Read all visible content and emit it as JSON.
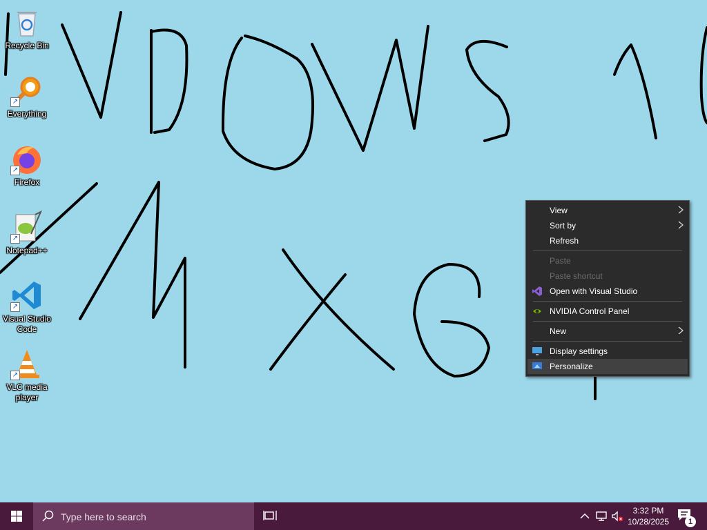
{
  "desktop": {
    "background_color": "#9cd8ea",
    "icons": [
      {
        "label": "Recycle Bin",
        "icon": "recycle-bin-icon",
        "shortcut": false
      },
      {
        "label": "Everything",
        "icon": "everything-search-icon",
        "shortcut": true
      },
      {
        "label": "Firefox",
        "icon": "firefox-icon",
        "shortcut": true
      },
      {
        "label": "Notepad++",
        "icon": "notepadpp-icon",
        "shortcut": true
      },
      {
        "label": "Visual Studio Code",
        "icon": "vscode-icon",
        "shortcut": true
      },
      {
        "label": "VLC media player",
        "icon": "vlc-icon",
        "shortcut": true
      }
    ]
  },
  "context_menu": {
    "items": [
      {
        "label": "View",
        "submenu": true,
        "disabled": false
      },
      {
        "label": "Sort by",
        "submenu": true,
        "disabled": false
      },
      {
        "label": "Refresh",
        "submenu": false,
        "disabled": false
      },
      {
        "label": "Paste",
        "submenu": false,
        "disabled": true
      },
      {
        "label": "Paste shortcut",
        "submenu": false,
        "disabled": true
      },
      {
        "label": "Open with Visual Studio",
        "icon": "visual-studio-icon",
        "submenu": false,
        "disabled": false
      },
      {
        "label": "NVIDIA Control Panel",
        "icon": "nvidia-icon",
        "submenu": false,
        "disabled": false
      },
      {
        "label": "New",
        "submenu": true,
        "disabled": false
      },
      {
        "label": "Display settings",
        "icon": "display-icon",
        "submenu": false,
        "disabled": false
      },
      {
        "label": "Personalize",
        "icon": "personalize-icon",
        "submenu": false,
        "disabled": false,
        "highlighted": true
      }
    ]
  },
  "taskbar": {
    "color": "#4a1a3d",
    "search_placeholder": "Type here to search",
    "time": "3:32 PM",
    "date": "10/28/2025",
    "notification_count": "1"
  }
}
